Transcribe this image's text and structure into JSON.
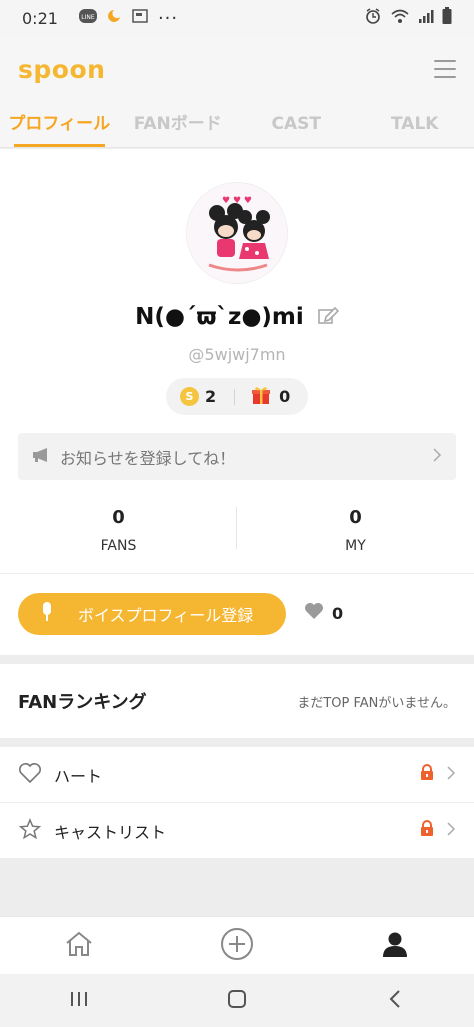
{
  "status_bar": {
    "time": "0:21",
    "dots": "···"
  },
  "app": {
    "logo": "spoon"
  },
  "tabs": [
    {
      "label": "プロフィール",
      "active": true
    },
    {
      "label": "FANボード",
      "active": false
    },
    {
      "label": "CAST",
      "active": false
    },
    {
      "label": "TALK",
      "active": false
    }
  ],
  "profile": {
    "name": "N(●´ϖ`z●)mi",
    "handle": "@5wjwj7mn",
    "coins": "2",
    "gifts": "0"
  },
  "notice": {
    "text": "お知らせを登録してね！"
  },
  "stats": [
    {
      "value": "0",
      "label": "FANS"
    },
    {
      "value": "0",
      "label": "MY"
    }
  ],
  "voice_profile": {
    "button_label": "ボイスプロフィール登録",
    "likes": "0"
  },
  "ranking": {
    "title": "FANランキング",
    "empty_text": "まだTOP FANがいません。"
  },
  "lists": [
    {
      "label": "ハート",
      "icon": "heart-outline-icon"
    },
    {
      "label": "キャストリスト",
      "icon": "star-outline-icon"
    }
  ],
  "colors": {
    "accent": "#f5b731",
    "tab_active": "#f5a623",
    "lock": "#f0622d"
  },
  "bottom_nav": [
    "home-icon",
    "add-circle-icon",
    "profile-icon"
  ]
}
